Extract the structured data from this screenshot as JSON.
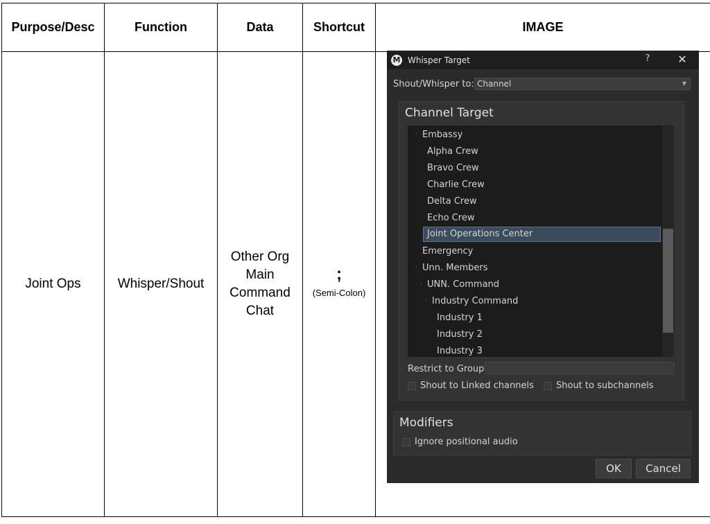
{
  "table": {
    "headers": [
      "Purpose/Desc",
      "Function",
      "Data",
      "Shortcut",
      "IMAGE"
    ],
    "row": {
      "purpose": "Joint Ops",
      "function": "Whisper/Shout",
      "data": "Other Org Main Command Chat",
      "shortcut_key": ";",
      "shortcut_caption": "(Semi-Colon)"
    }
  },
  "dialog": {
    "title": "Whisper Target",
    "help_glyph": "?",
    "close_glyph": "✕",
    "shout_whisper_label": "Shout/Whisper to:",
    "shout_whisper_value": "Channel",
    "channel_target_title": "Channel Target",
    "tree_items": [
      "Embassy",
      "Alpha Crew",
      "Bravo Crew",
      "Charlie Crew",
      "Delta Crew",
      "Echo Crew",
      "Joint Operations Center",
      "Emergency",
      "Unn. Members",
      "UNN. Command",
      "Industry Command",
      "Industry 1",
      "Industry 2",
      "Industry 3"
    ],
    "selected_item": "Joint Operations Center",
    "restrict_label": "Restrict to Group",
    "restrict_value": "",
    "shout_linked_label": "Shout to Linked channels",
    "shout_sub_label": "Shout to subchannels",
    "modifiers_title": "Modifiers",
    "ignore_positional_label": "Ignore positional audio",
    "ok_label": "OK",
    "cancel_label": "Cancel"
  }
}
